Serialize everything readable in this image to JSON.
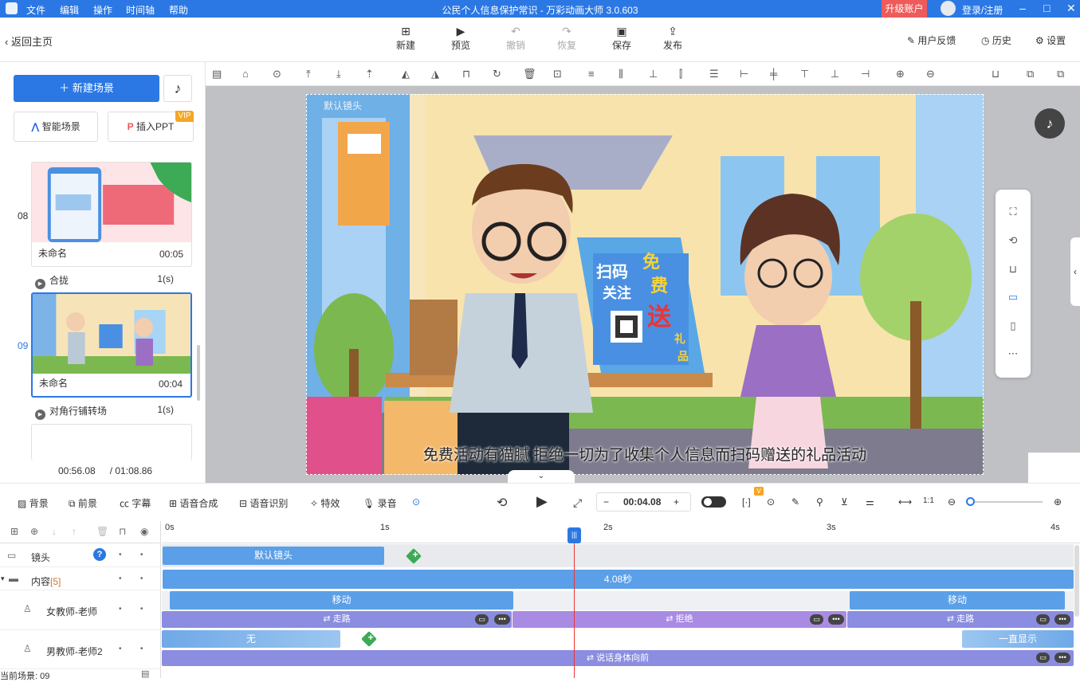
{
  "menu": [
    "文件",
    "编辑",
    "操作",
    "时间轴",
    "帮助"
  ],
  "window_title": "公民个人信息保护常识 - 万彩动画大师 3.0.603",
  "upgrade": "升级账户",
  "login": "登录/注册",
  "back": "返回主页",
  "toolbar": {
    "new": "新建",
    "preview": "预览",
    "undo": "撤销",
    "redo": "恢复",
    "save": "保存",
    "publish": "发布",
    "feedback": "用户反馈",
    "history": "历史",
    "settings": "设置"
  },
  "left": {
    "new_scene": "新建场景",
    "smart_scene": "智能场景",
    "insert_ppt": "插入PPT",
    "vip": "VIP",
    "scenes": [
      {
        "num": "08",
        "name": "未命名",
        "duration": "00:05"
      },
      {
        "num": "09",
        "name": "未命名",
        "duration": "00:04"
      }
    ],
    "transitions": [
      {
        "name": "合拢",
        "time": "1(s)"
      },
      {
        "name": "对角行铺转场",
        "time": "1(s)"
      }
    ],
    "current_time": "00:56.08",
    "total_time": "/ 01:08.86"
  },
  "stage": {
    "camera_label": "默认镜头",
    "subtitle": "免费活动有猫腻 拒绝一切为了收集个人信息而扫码赠送的礼品活动",
    "sign_text": [
      "扫码",
      "关注",
      "免",
      "费",
      "送",
      "礼",
      "品"
    ]
  },
  "timeline_toolbar": {
    "background": "背景",
    "foreground": "前景",
    "caption": "字幕",
    "tts": "语音合成",
    "asr": "语音识别",
    "effects": "特效",
    "record": "录音",
    "time": "00:04.08",
    "badge": "V"
  },
  "timeline": {
    "ticks": [
      "0s",
      "1s",
      "2s",
      "3s",
      "4s"
    ],
    "rows": {
      "camera": "镜头",
      "content": "内容",
      "content_count": "[5]",
      "female": "女教师-老师",
      "male": "男教师-老师2"
    },
    "current_scene": "当前场景: 09",
    "segments": {
      "camera": "默认镜头",
      "content": "4.08秒",
      "move1": "移动",
      "move2": "移动",
      "walk1": "走路",
      "refuse": "拒绝",
      "walk2": "走路",
      "none": "无",
      "always": "一直显示",
      "talk": "说话身体向前"
    }
  }
}
